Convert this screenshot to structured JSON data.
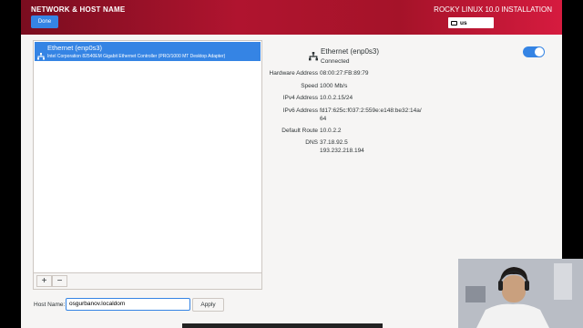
{
  "header": {
    "title": "NETWORK & HOST NAME",
    "done_label": "Done",
    "install_title": "ROCKY LINUX 10.0 INSTALLATION",
    "keyboard_layout": "us"
  },
  "device_list": {
    "items": [
      {
        "name": "Ethernet (enp0s3)",
        "description": "Intel Corporation 82540EM Gigabit Ethernet Controller (PRO/1000 MT Desktop Adapter)",
        "selected": true
      }
    ],
    "add_label": "+",
    "remove_label": "−"
  },
  "details": {
    "name": "Ethernet (enp0s3)",
    "status": "Connected",
    "toggle_on": true,
    "fields": {
      "hardware_address": {
        "label": "Hardware Address",
        "value": "08:00:27:FB:89:79"
      },
      "speed": {
        "label": "Speed",
        "value": "1000 Mb/s"
      },
      "ipv4": {
        "label": "IPv4 Address",
        "value": "10.0.2.15/24"
      },
      "ipv6": {
        "label": "IPv6 Address",
        "value_line1": "fd17:625c:f037:2:559e:e148:be32:14a/",
        "value_line2": "64"
      },
      "route": {
        "label": "Default Route",
        "value": "10.0.2.2"
      },
      "dns": {
        "label": "DNS",
        "value_line1": "37.18.92.5",
        "value_line2": "193.232.218.194"
      }
    }
  },
  "hostname": {
    "label": "Host Name:",
    "value": "osgurbanov.localdom",
    "apply_label": "Apply"
  },
  "colors": {
    "accent": "#3584e4",
    "header_red": "#b0142f"
  }
}
